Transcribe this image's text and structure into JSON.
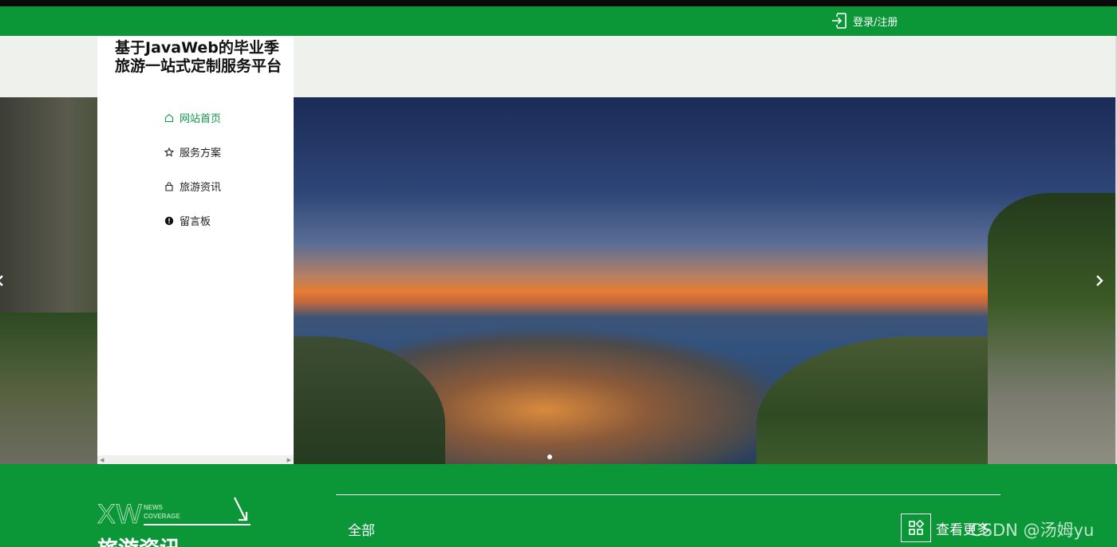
{
  "topbar": {
    "login_label": "登录/注册",
    "login_icon": "login-icon"
  },
  "site": {
    "title": "基于JavaWeb的毕业季旅游一站式定制服务平台"
  },
  "nav": {
    "items": [
      {
        "label": "网站首页",
        "icon": "home-icon",
        "active": true
      },
      {
        "label": "服务方案",
        "icon": "star-icon",
        "active": false
      },
      {
        "label": "旅游资讯",
        "icon": "bag-icon",
        "active": false
      },
      {
        "label": "留言板",
        "icon": "alert-circle-icon",
        "active": false
      }
    ]
  },
  "banner": {
    "slide_count": 1,
    "active_slide": 1
  },
  "news_section": {
    "abbr": "XW",
    "tag_line1": "NEWS",
    "tag_line2": "COVERAGE",
    "title": "旅游资讯",
    "tab_all": "全部",
    "more_label": "查看更多",
    "more_icon": "grid-icon"
  },
  "watermark": "CSDN @汤姆yu",
  "colors": {
    "brand_green": "#0b9637",
    "nav_active": "#12954a",
    "subheader_bg": "#eef1ec"
  }
}
